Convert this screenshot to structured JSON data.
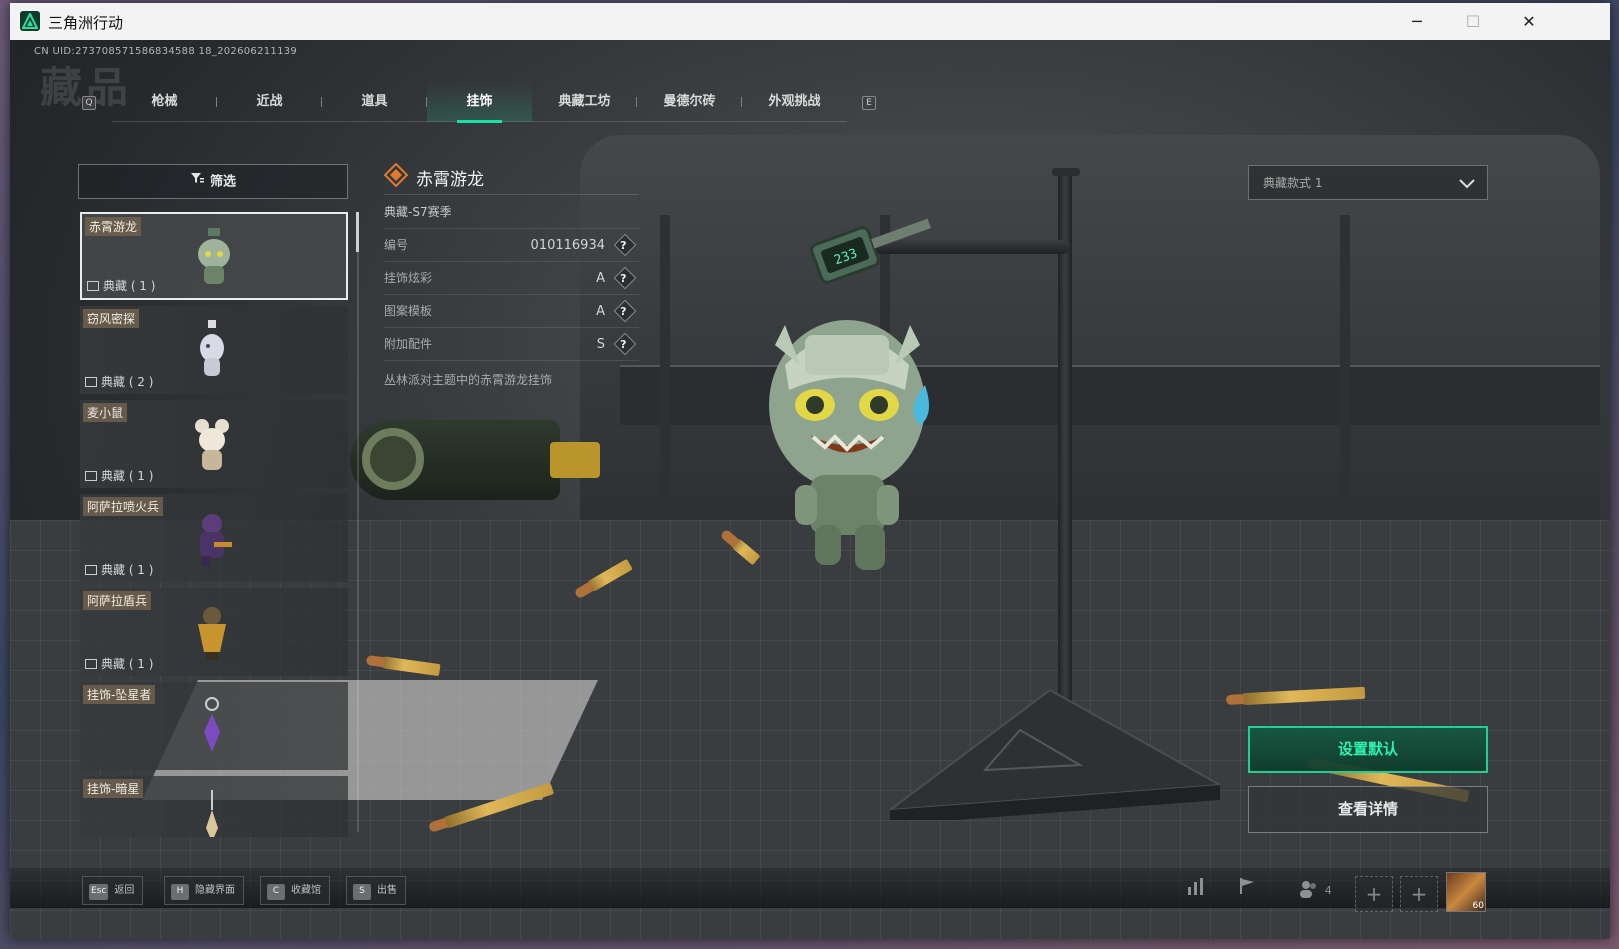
{
  "window": {
    "title": "三角洲行动",
    "minimize": "─",
    "maximize": "☐",
    "close": "✕"
  },
  "uid": "CN UID:273708571586834588 18_202606211139",
  "page_title": "藏品",
  "tabs": {
    "left_key": "Q",
    "right_key": "E",
    "items": [
      {
        "label": "枪械"
      },
      {
        "label": "近战"
      },
      {
        "label": "道具"
      },
      {
        "label": "挂饰"
      },
      {
        "label": "典藏工坊"
      },
      {
        "label": "曼德尔砖"
      },
      {
        "label": "外观挑战"
      }
    ],
    "active_index": 3
  },
  "filter": {
    "label": "筛选"
  },
  "items": [
    {
      "name": "赤霄游龙",
      "tag": "典藏 ( 1 )",
      "selected": true
    },
    {
      "name": "窃风密探",
      "tag": "典藏 ( 2 )"
    },
    {
      "name": "麦小鼠",
      "tag": "典藏 ( 1 )"
    },
    {
      "name": "阿萨拉喷火兵",
      "tag": "典藏 ( 1 )"
    },
    {
      "name": "阿萨拉盾兵",
      "tag": "典藏 ( 1 )"
    },
    {
      "name": "挂饰-坠星者",
      "tag": ""
    },
    {
      "name": "挂饰-暗星",
      "tag": ""
    }
  ],
  "detail": {
    "name": "赤霄游龙",
    "season": "典藏-S7赛季",
    "attributes": [
      {
        "label": "编号",
        "value": "010116934",
        "help": "?"
      },
      {
        "label": "挂饰炫彩",
        "value": "A",
        "help": "?"
      },
      {
        "label": "图案模板",
        "value": "A",
        "help": "?"
      },
      {
        "label": "附加配件",
        "value": "S",
        "help": "?"
      }
    ],
    "description": "丛林派对主题中的赤霄游龙挂饰"
  },
  "variant": {
    "selected": "典藏款式 1"
  },
  "scale_display": "233",
  "buttons": {
    "set_default": "设置默认",
    "view_details": "查看详情"
  },
  "bottom_hints": [
    {
      "key": "Esc",
      "label": "返回"
    },
    {
      "key": "H",
      "label": "隐藏界面"
    },
    {
      "key": "C",
      "label": "收藏馆"
    },
    {
      "key": "S",
      "label": "出售"
    }
  ],
  "bottom_right": {
    "party_count": "4",
    "avatar_level": "60"
  },
  "colors": {
    "accent": "#19e0a4",
    "button_text": "#2ef0b0"
  },
  "icons": {
    "stats": "bar-chart-icon",
    "flag": "flag-icon",
    "party": "people-icon",
    "add": "plus-icon"
  }
}
